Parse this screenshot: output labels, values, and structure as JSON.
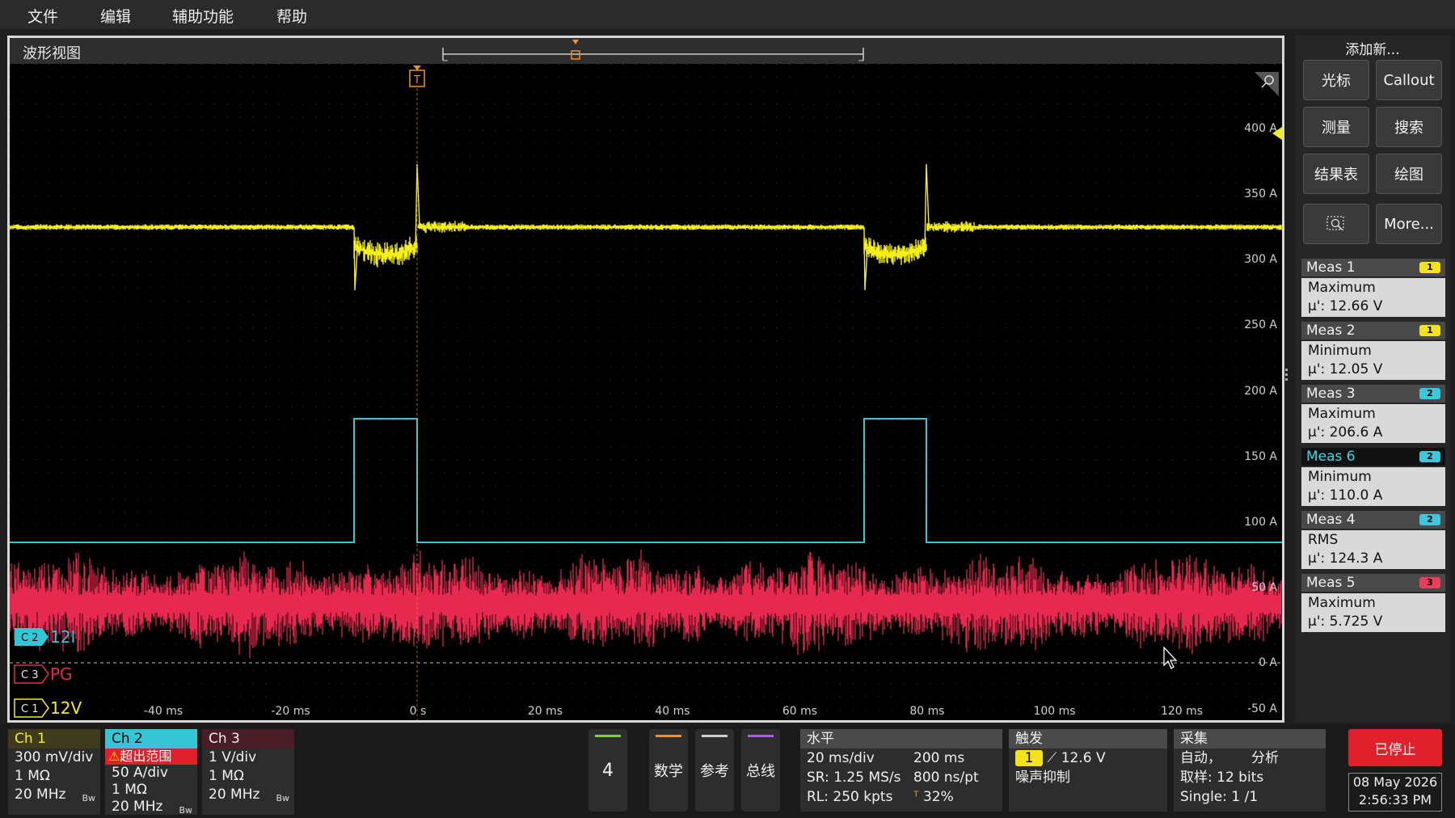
{
  "menu": [
    "文件",
    "编辑",
    "辅助功能",
    "帮助"
  ],
  "waveform_view": {
    "title": "波形视图",
    "trigger_marker": "T",
    "y_ticks": [
      "400 A",
      "350 A",
      "300 A",
      "250 A",
      "200 A",
      "150 A",
      "100 A",
      "50 A",
      "0 A",
      "-50 A"
    ],
    "x_ticks": [
      "-40 ms",
      "-20 ms",
      "0 s",
      "20 ms",
      "40 ms",
      "60 ms",
      "80 ms",
      "100 ms",
      "120 ms"
    ],
    "channel_labels": [
      {
        "tag": "C 2",
        "name": "12I",
        "color": "#35c6d6"
      },
      {
        "tag": "C 3",
        "name": "PG",
        "color": "#e8294f"
      },
      {
        "tag": "C 1",
        "name": "12V",
        "color": "#f4ee1a"
      }
    ]
  },
  "right_panel": {
    "add_new": "添加新...",
    "buttons": [
      "光标",
      "Callout",
      "测量",
      "搜索",
      "结果表",
      "绘图",
      "",
      "More..."
    ],
    "measurements": [
      {
        "title": "Meas 1",
        "badge": "1",
        "badge_color": "#f4e21a",
        "type": "Maximum",
        "value": "µ': 12.66 V"
      },
      {
        "title": "Meas 2",
        "badge": "1",
        "badge_color": "#f4e21a",
        "type": "Minimum",
        "value": "µ': 12.05 V"
      },
      {
        "title": "Meas 3",
        "badge": "2",
        "badge_color": "#3cc8d8",
        "type": "Maximum",
        "value": "µ': 206.6 A"
      },
      {
        "title": "Meas 6",
        "badge": "2",
        "badge_color": "#3cc8d8",
        "type": "Minimum",
        "value": "µ': 110.0 A"
      },
      {
        "title": "Meas 4",
        "badge": "2",
        "badge_color": "#3cc8d8",
        "type": "RMS",
        "value": "µ': 124.3 A"
      },
      {
        "title": "Meas 5",
        "badge": "3",
        "badge_color": "#e8405a",
        "type": "Maximum",
        "value": "µ': 5.725 V"
      }
    ]
  },
  "bottom": {
    "ch1": {
      "title": "Ch 1",
      "lines": [
        "300 mV/div",
        "1 MΩ",
        "20 MHz"
      ],
      "bw": "Bw"
    },
    "ch2": {
      "title": "Ch 2",
      "warning": "超出范围",
      "lines": [
        "50 A/div",
        "1 MΩ",
        "20 MHz"
      ],
      "bw": "Bw"
    },
    "ch3": {
      "title": "Ch 3",
      "lines": [
        "1 V/div",
        "1 MΩ",
        "20 MHz"
      ],
      "bw": "Bw"
    },
    "ch4_label": "4",
    "math": "数学",
    "ref": "参考",
    "bus": "总线",
    "horizontal": {
      "title": "水平",
      "row1a": "20 ms/div",
      "row1b": "200 ms",
      "row2a": "SR: 1.25 MS/s",
      "row2b": "800 ns/pt",
      "row3a": "RL: 250 kpts",
      "row3b": "32%"
    },
    "trigger": {
      "title": "触发",
      "source": "1",
      "level": "12.6 V",
      "mode": "噪声抑制"
    },
    "acquire": {
      "title": "采集",
      "row1a": "自动，",
      "row1b": "分析",
      "row2": "取样: 12 bits",
      "row3": "Single: 1 /1"
    },
    "stop_label": "已停止",
    "date": "08 May 2026",
    "time": "2:56:33 PM"
  }
}
